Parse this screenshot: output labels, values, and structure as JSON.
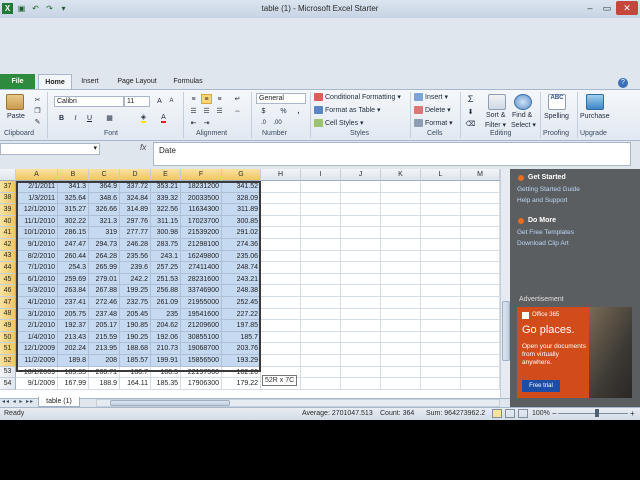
{
  "window": {
    "title": "table (1) - Microsoft Excel Starter"
  },
  "tabs": {
    "file": "File",
    "home": "Home",
    "insert": "Insert",
    "page_layout": "Page Layout",
    "formulas": "Formulas"
  },
  "ribbon": {
    "clipboard": {
      "label": "Clipboard",
      "paste": "Paste"
    },
    "font": {
      "label": "Font",
      "name": "Calibri",
      "size": "11",
      "bold": "B",
      "italic": "I",
      "underline": "U"
    },
    "alignment": {
      "label": "Alignment"
    },
    "number": {
      "label": "Number",
      "format": "General",
      "currency": "$",
      "percent": "%",
      "comma": ","
    },
    "styles": {
      "label": "Styles",
      "conditional": "Conditional Formatting",
      "format_table": "Format as Table",
      "cell_styles": "Cell Styles"
    },
    "cells": {
      "label": "Cells",
      "insert": "Insert",
      "delete": "Delete",
      "format": "Format"
    },
    "editing": {
      "label": "Editing",
      "sum": "Σ",
      "sort": "Sort &",
      "filter": "Filter",
      "find": "Find &",
      "select": "Select"
    },
    "proofing": {
      "label": "Proofing",
      "spelling": "Spelling"
    },
    "upgrade": {
      "label": "Upgrade",
      "purchase": "Purchase"
    }
  },
  "formula_bar": {
    "fx": "fx",
    "value": "Date"
  },
  "columns": [
    "A",
    "B",
    "C",
    "D",
    "E",
    "F",
    "G",
    "H",
    "I",
    "J",
    "K",
    "L",
    "M"
  ],
  "rows": [
    {
      "n": "37",
      "cells": [
        "2/1/2011",
        "341.3",
        "364.9",
        "337.72",
        "353.21",
        "18231200",
        "341.52"
      ]
    },
    {
      "n": "38",
      "cells": [
        "1/3/2011",
        "325.64",
        "348.6",
        "324.84",
        "339.32",
        "20033500",
        "328.09"
      ]
    },
    {
      "n": "39",
      "cells": [
        "12/1/2010",
        "315.27",
        "326.66",
        "314.89",
        "322.56",
        "11634300",
        "311.89"
      ]
    },
    {
      "n": "40",
      "cells": [
        "11/1/2010",
        "302.22",
        "321.3",
        "297.76",
        "311.15",
        "17023700",
        "300.85"
      ]
    },
    {
      "n": "41",
      "cells": [
        "10/1/2010",
        "286.15",
        "319",
        "277.77",
        "300.98",
        "21539200",
        "291.02"
      ]
    },
    {
      "n": "42",
      "cells": [
        "9/1/2010",
        "247.47",
        "294.73",
        "246.28",
        "283.75",
        "21298100",
        "274.36"
      ]
    },
    {
      "n": "43",
      "cells": [
        "8/2/2010",
        "260.44",
        "264.28",
        "235.56",
        "243.1",
        "16249800",
        "235.06"
      ]
    },
    {
      "n": "44",
      "cells": [
        "7/1/2010",
        "254.3",
        "265.99",
        "239.6",
        "257.25",
        "27411400",
        "248.74"
      ]
    },
    {
      "n": "45",
      "cells": [
        "6/1/2010",
        "259.69",
        "279.01",
        "242.2",
        "251.53",
        "28231600",
        "243.21"
      ]
    },
    {
      "n": "46",
      "cells": [
        "5/3/2010",
        "263.84",
        "267.88",
        "199.25",
        "256.88",
        "33746900",
        "248.38"
      ]
    },
    {
      "n": "47",
      "cells": [
        "4/1/2010",
        "237.41",
        "272.46",
        "232.75",
        "261.09",
        "21955000",
        "252.45"
      ]
    },
    {
      "n": "48",
      "cells": [
        "3/1/2010",
        "205.75",
        "237.48",
        "205.45",
        "235",
        "19541600",
        "227.22"
      ]
    },
    {
      "n": "49",
      "cells": [
        "2/1/2010",
        "192.37",
        "205.17",
        "190.85",
        "204.62",
        "21209600",
        "197.85"
      ]
    },
    {
      "n": "50",
      "cells": [
        "1/4/2010",
        "213.43",
        "215.59",
        "190.25",
        "192.06",
        "30855100",
        "185.7"
      ]
    },
    {
      "n": "51",
      "cells": [
        "12/1/2009",
        "202.24",
        "213.95",
        "188.68",
        "210.73",
        "19068700",
        "203.76"
      ]
    },
    {
      "n": "52",
      "cells": [
        "11/2/2009",
        "189.8",
        "208",
        "185.57",
        "199.91",
        "15856500",
        "193.29"
      ]
    },
    {
      "n": "53",
      "cells": [
        "10/1/2009",
        "185.35",
        "208.71",
        "180.7",
        "188.5",
        "22197500",
        "182.26"
      ]
    },
    {
      "n": "54",
      "cells": [
        "9/1/2009",
        "167.99",
        "188.9",
        "164.11",
        "185.35",
        "17906300",
        "179.22"
      ]
    }
  ],
  "selection_tooltip": "52R x 7C",
  "sheet_tab": "table (1)",
  "side_panel": {
    "get_started": "Get Started",
    "guide_link": "Getting Started Guide",
    "help_link": "Help and Support",
    "do_more": "Do More",
    "templates_link": "Get Free Templates",
    "clipart_link": "Download Clip Art",
    "ad_label": "Advertisement",
    "ad_logo": "Office 365",
    "ad_headline": "Go places.",
    "ad_body": "Open your documents from virtually anywhere.",
    "ad_button": "Free trial"
  },
  "status": {
    "ready": "Ready",
    "average": "Average: 2701047.513",
    "count": "Count: 364",
    "sum": "Sum: 964273962.2",
    "zoom": "100%"
  }
}
